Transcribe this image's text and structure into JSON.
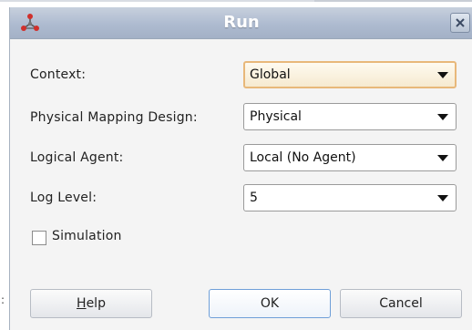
{
  "window": {
    "title": "Run",
    "app_icon": "odi-agent-icon",
    "close_icon": "close-icon"
  },
  "fields": [
    {
      "label": "Context:",
      "value": "Global"
    },
    {
      "label": "Physical Mapping Design:",
      "value": "Physical"
    },
    {
      "label": "Logical Agent:",
      "value": "Local (No Agent)"
    },
    {
      "label": "Log Level:",
      "value": "5"
    }
  ],
  "simulation": {
    "label": "Simulation",
    "checked": false
  },
  "buttons": {
    "help": {
      "mnemonic": "H",
      "rest": "elp"
    },
    "ok": "OK",
    "cancel": "Cancel"
  },
  "colors": {
    "titlebar": "#aebbd0",
    "focus_border": "#e8b87a",
    "default_button_border": "#6f9fd8"
  }
}
